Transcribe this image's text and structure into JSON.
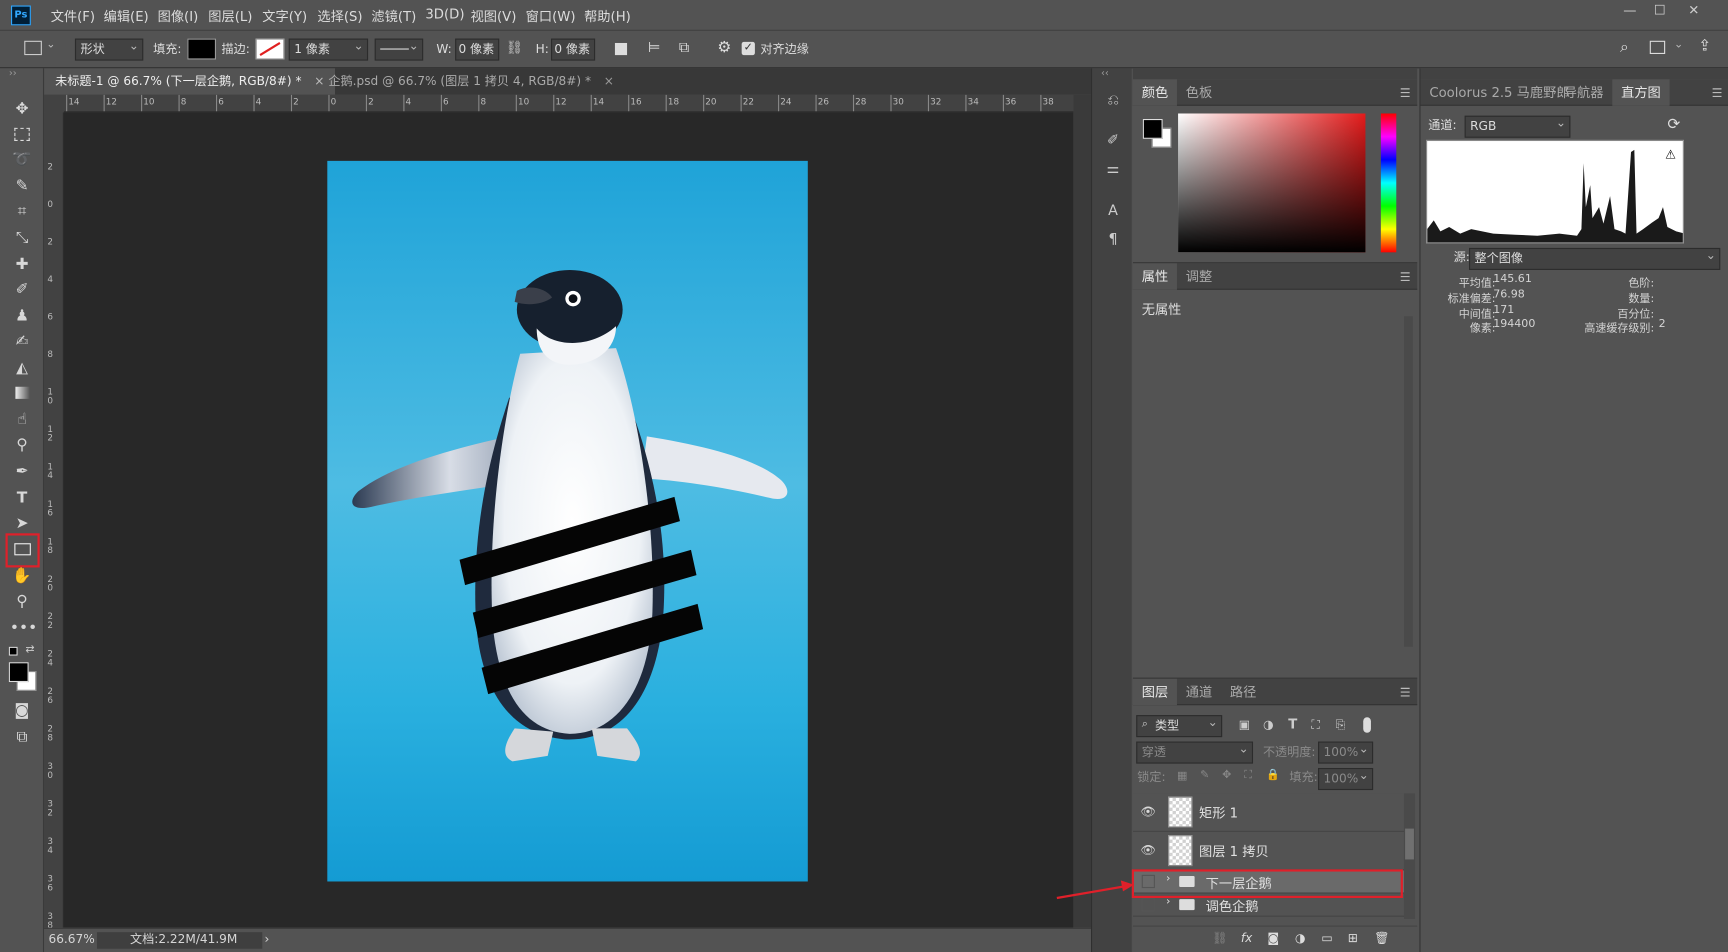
{
  "app": {
    "logo": "Ps"
  },
  "menu": [
    "文件(F)",
    "编辑(E)",
    "图像(I)",
    "图层(L)",
    "文字(Y)",
    "选择(S)",
    "滤镜(T)",
    "3D(D)",
    "视图(V)",
    "窗口(W)",
    "帮助(H)"
  ],
  "window_controls": {
    "minimize": "—",
    "maximize": "☐",
    "close": "✕"
  },
  "options": {
    "mode": "形状",
    "fill_label": "填充:",
    "stroke_label": "描边:",
    "stroke_width": "1 像素",
    "w_label": "W:",
    "w_value": "0 像素",
    "h_label": "H:",
    "h_value": "0 像素",
    "align_edges": "对齐边缘",
    "fill_color": "#000000"
  },
  "tabs": [
    {
      "label": "未标题-1 @ 66.7% (下一层企鹅, RGB/8#) *",
      "close": "×",
      "active": true
    },
    {
      "label": "企鹅.psd @ 66.7% (图层 1 拷贝 4, RGB/8#) *",
      "close": "×",
      "active": false
    }
  ],
  "hruler": [
    "14",
    "12",
    "10",
    "8",
    "6",
    "4",
    "2",
    "0",
    "2",
    "4",
    "6",
    "8",
    "10",
    "12",
    "14",
    "16",
    "18",
    "20",
    "22",
    "24",
    "26",
    "28",
    "30",
    "32",
    "34",
    "36",
    "38"
  ],
  "vruler": [
    "2",
    "0",
    "2",
    "4",
    "6",
    "8",
    "1 0",
    "1 2",
    "1 4",
    "1 6",
    "1 8",
    "2 0",
    "2 2",
    "2 4",
    "2 6",
    "2 8",
    "3 0",
    "3 2",
    "3 4",
    "3 6",
    "3 8"
  ],
  "status": {
    "zoom": "66.67%",
    "doc": "文档:2.22M/41.9M",
    "arrow": "›"
  },
  "color_panel": {
    "tabs": [
      "颜色",
      "色板"
    ],
    "foreground": "#000000",
    "background": "#ffffff",
    "hue_color": "#e41b1b"
  },
  "props_panel": {
    "tabs": [
      "属性",
      "调整"
    ],
    "content": "无属性"
  },
  "right_panel": {
    "tabs": [
      "Coolorus 2.5 马鹿野郎",
      "导航器",
      "直方图"
    ],
    "channel_label": "通道:",
    "channel": "RGB",
    "warning": "⚠",
    "source_label": "源:",
    "source": "整个图像",
    "stats": [
      {
        "k": "平均值:",
        "v": "145.61"
      },
      {
        "k": "标准偏差:",
        "v": "76.98"
      },
      {
        "k": "中间值:",
        "v": "171"
      },
      {
        "k": "像素:",
        "v": "194400"
      }
    ],
    "stats2": [
      {
        "k": "色阶:",
        "v": ""
      },
      {
        "k": "数量:",
        "v": ""
      },
      {
        "k": "百分位:",
        "v": ""
      },
      {
        "k": "高速缓存级别:",
        "v": "2"
      }
    ]
  },
  "layers_panel": {
    "tabs": [
      "图层",
      "通道",
      "路径"
    ],
    "filter": "类型",
    "blend": "穿透",
    "opacity_label": "不透明度:",
    "opacity": "100%",
    "lock_label": "锁定:",
    "fill_label": "填充:",
    "fill": "100%",
    "layers": [
      {
        "name": "矩形 1",
        "visible": true,
        "type": "shape"
      },
      {
        "name": "图层 1 拷贝",
        "visible": true,
        "type": "pixel"
      },
      {
        "name": "下一层企鹅",
        "visible": false,
        "type": "group",
        "selected": true
      },
      {
        "name": "调色企鹅",
        "visible": false,
        "type": "group"
      }
    ],
    "footer_icons": [
      "link-icon",
      "fx-icon",
      "mask-icon",
      "adjustment-icon",
      "folder-icon",
      "new-layer-icon",
      "trash-icon"
    ]
  },
  "annotations": {
    "highlight_color": "#e0202a"
  }
}
